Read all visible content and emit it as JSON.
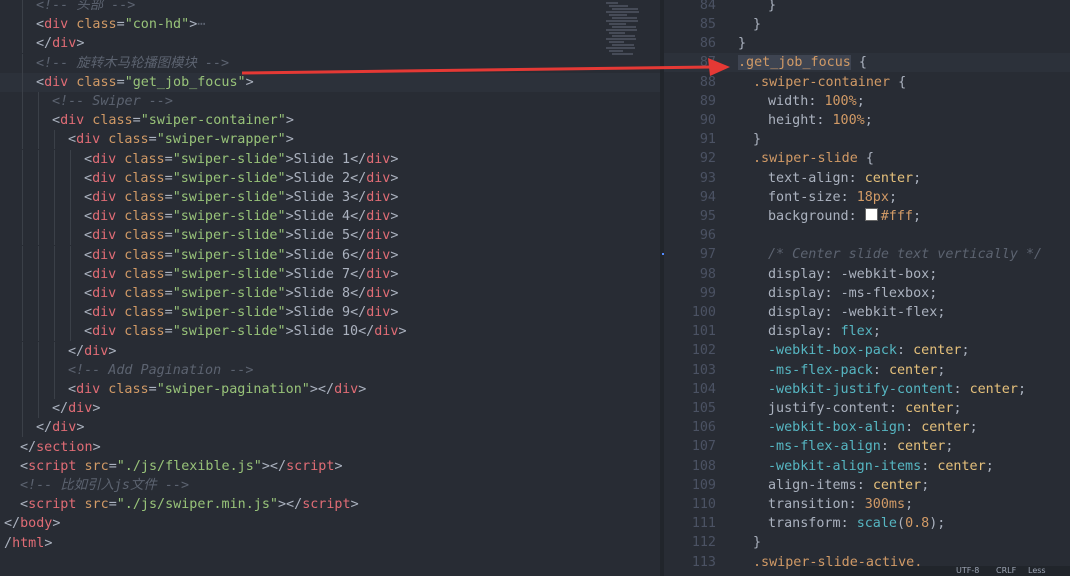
{
  "left_lines": [
    {
      "indent": 2,
      "html": [
        [
          "cm",
          "<!-- 头部 -->"
        ]
      ]
    },
    {
      "indent": 2,
      "html": [
        [
          "pn",
          "<"
        ],
        [
          "tg",
          "div"
        ],
        [
          "at",
          " class"
        ],
        [
          "pn",
          "="
        ],
        [
          "st",
          "\"con-hd\""
        ],
        [
          "pn",
          ">"
        ],
        [
          "cm",
          "⋯"
        ]
      ]
    },
    {
      "indent": 2,
      "html": [
        [
          "pn",
          "</"
        ],
        [
          "tg",
          "div"
        ],
        [
          "pn",
          ">"
        ]
      ]
    },
    {
      "indent": 2,
      "html": [
        [
          "cm",
          "<!-- 旋转木马轮播图模块 -->"
        ]
      ]
    },
    {
      "indent": 2,
      "html": [
        [
          "pn",
          "<"
        ],
        [
          "tg",
          "div"
        ],
        [
          "at",
          " class"
        ],
        [
          "pn",
          "="
        ],
        [
          "st",
          "\"get_job_focus\""
        ],
        [
          "pn",
          ">"
        ]
      ]
    },
    {
      "indent": 3,
      "html": [
        [
          "cm",
          "<!-- Swiper -->"
        ]
      ]
    },
    {
      "indent": 3,
      "html": [
        [
          "pn",
          "<"
        ],
        [
          "tg",
          "div"
        ],
        [
          "at",
          " class"
        ],
        [
          "pn",
          "="
        ],
        [
          "st",
          "\"swiper-container\""
        ],
        [
          "pn",
          ">"
        ]
      ]
    },
    {
      "indent": 4,
      "html": [
        [
          "pn",
          "<"
        ],
        [
          "tg",
          "div"
        ],
        [
          "at",
          " class"
        ],
        [
          "pn",
          "="
        ],
        [
          "st",
          "\"swiper-wrapper\""
        ],
        [
          "pn",
          ">"
        ]
      ]
    },
    {
      "indent": 5,
      "html": [
        [
          "pn",
          "<"
        ],
        [
          "tg",
          "div"
        ],
        [
          "at",
          " class"
        ],
        [
          "pn",
          "="
        ],
        [
          "st",
          "\"swiper-slide\""
        ],
        [
          "pn",
          ">"
        ],
        [
          "tx",
          "Slide 1"
        ],
        [
          "pn",
          "</"
        ],
        [
          "tg",
          "div"
        ],
        [
          "pn",
          ">"
        ]
      ]
    },
    {
      "indent": 5,
      "html": [
        [
          "pn",
          "<"
        ],
        [
          "tg",
          "div"
        ],
        [
          "at",
          " class"
        ],
        [
          "pn",
          "="
        ],
        [
          "st",
          "\"swiper-slide\""
        ],
        [
          "pn",
          ">"
        ],
        [
          "tx",
          "Slide 2"
        ],
        [
          "pn",
          "</"
        ],
        [
          "tg",
          "div"
        ],
        [
          "pn",
          ">"
        ]
      ]
    },
    {
      "indent": 5,
      "html": [
        [
          "pn",
          "<"
        ],
        [
          "tg",
          "div"
        ],
        [
          "at",
          " class"
        ],
        [
          "pn",
          "="
        ],
        [
          "st",
          "\"swiper-slide\""
        ],
        [
          "pn",
          ">"
        ],
        [
          "tx",
          "Slide 3"
        ],
        [
          "pn",
          "</"
        ],
        [
          "tg",
          "div"
        ],
        [
          "pn",
          ">"
        ]
      ]
    },
    {
      "indent": 5,
      "html": [
        [
          "pn",
          "<"
        ],
        [
          "tg",
          "div"
        ],
        [
          "at",
          " class"
        ],
        [
          "pn",
          "="
        ],
        [
          "st",
          "\"swiper-slide\""
        ],
        [
          "pn",
          ">"
        ],
        [
          "tx",
          "Slide 4"
        ],
        [
          "pn",
          "</"
        ],
        [
          "tg",
          "div"
        ],
        [
          "pn",
          ">"
        ]
      ]
    },
    {
      "indent": 5,
      "html": [
        [
          "pn",
          "<"
        ],
        [
          "tg",
          "div"
        ],
        [
          "at",
          " class"
        ],
        [
          "pn",
          "="
        ],
        [
          "st",
          "\"swiper-slide\""
        ],
        [
          "pn",
          ">"
        ],
        [
          "tx",
          "Slide 5"
        ],
        [
          "pn",
          "</"
        ],
        [
          "tg",
          "div"
        ],
        [
          "pn",
          ">"
        ]
      ]
    },
    {
      "indent": 5,
      "html": [
        [
          "pn",
          "<"
        ],
        [
          "tg",
          "div"
        ],
        [
          "at",
          " class"
        ],
        [
          "pn",
          "="
        ],
        [
          "st",
          "\"swiper-slide\""
        ],
        [
          "pn",
          ">"
        ],
        [
          "tx",
          "Slide 6"
        ],
        [
          "pn",
          "</"
        ],
        [
          "tg",
          "div"
        ],
        [
          "pn",
          ">"
        ]
      ]
    },
    {
      "indent": 5,
      "html": [
        [
          "pn",
          "<"
        ],
        [
          "tg",
          "div"
        ],
        [
          "at",
          " class"
        ],
        [
          "pn",
          "="
        ],
        [
          "st",
          "\"swiper-slide\""
        ],
        [
          "pn",
          ">"
        ],
        [
          "tx",
          "Slide 7"
        ],
        [
          "pn",
          "</"
        ],
        [
          "tg",
          "div"
        ],
        [
          "pn",
          ">"
        ]
      ]
    },
    {
      "indent": 5,
      "html": [
        [
          "pn",
          "<"
        ],
        [
          "tg",
          "div"
        ],
        [
          "at",
          " class"
        ],
        [
          "pn",
          "="
        ],
        [
          "st",
          "\"swiper-slide\""
        ],
        [
          "pn",
          ">"
        ],
        [
          "tx",
          "Slide 8"
        ],
        [
          "pn",
          "</"
        ],
        [
          "tg",
          "div"
        ],
        [
          "pn",
          ">"
        ]
      ]
    },
    {
      "indent": 5,
      "html": [
        [
          "pn",
          "<"
        ],
        [
          "tg",
          "div"
        ],
        [
          "at",
          " class"
        ],
        [
          "pn",
          "="
        ],
        [
          "st",
          "\"swiper-slide\""
        ],
        [
          "pn",
          ">"
        ],
        [
          "tx",
          "Slide 9"
        ],
        [
          "pn",
          "</"
        ],
        [
          "tg",
          "div"
        ],
        [
          "pn",
          ">"
        ]
      ]
    },
    {
      "indent": 5,
      "html": [
        [
          "pn",
          "<"
        ],
        [
          "tg",
          "div"
        ],
        [
          "at",
          " class"
        ],
        [
          "pn",
          "="
        ],
        [
          "st",
          "\"swiper-slide\""
        ],
        [
          "pn",
          ">"
        ],
        [
          "tx",
          "Slide 10"
        ],
        [
          "pn",
          "</"
        ],
        [
          "tg",
          "div"
        ],
        [
          "pn",
          ">"
        ]
      ]
    },
    {
      "indent": 4,
      "html": [
        [
          "pn",
          "</"
        ],
        [
          "tg",
          "div"
        ],
        [
          "pn",
          ">"
        ]
      ]
    },
    {
      "indent": 4,
      "html": [
        [
          "cm",
          "<!-- Add Pagination -->"
        ]
      ]
    },
    {
      "indent": 4,
      "html": [
        [
          "pn",
          "<"
        ],
        [
          "tg",
          "div"
        ],
        [
          "at",
          " class"
        ],
        [
          "pn",
          "="
        ],
        [
          "st",
          "\"swiper-pagination\""
        ],
        [
          "pn",
          "></"
        ],
        [
          "tg",
          "div"
        ],
        [
          "pn",
          ">"
        ]
      ]
    },
    {
      "indent": 3,
      "html": [
        [
          "pn",
          "</"
        ],
        [
          "tg",
          "div"
        ],
        [
          "pn",
          ">"
        ]
      ]
    },
    {
      "indent": 2,
      "html": [
        [
          "pn",
          "</"
        ],
        [
          "tg",
          "div"
        ],
        [
          "pn",
          ">"
        ]
      ]
    },
    {
      "indent": 1,
      "html": [
        [
          "pn",
          "</"
        ],
        [
          "tg",
          "section"
        ],
        [
          "pn",
          ">"
        ]
      ]
    },
    {
      "indent": 1,
      "html": [
        [
          "pn",
          "<"
        ],
        [
          "tg",
          "script"
        ],
        [
          "at",
          " src"
        ],
        [
          "pn",
          "="
        ],
        [
          "st",
          "\"./js/flexible.js\""
        ],
        [
          "pn",
          "></"
        ],
        [
          "tg",
          "script"
        ],
        [
          "pn",
          ">"
        ]
      ]
    },
    {
      "indent": 1,
      "html": [
        [
          "cm",
          "<!-- 比如引入js文件 -->"
        ]
      ]
    },
    {
      "indent": 1,
      "html": [
        [
          "pn",
          "<"
        ],
        [
          "tg",
          "script"
        ],
        [
          "at",
          " src"
        ],
        [
          "pn",
          "="
        ],
        [
          "st",
          "\"./js/swiper.min.js\""
        ],
        [
          "pn",
          "></"
        ],
        [
          "tg",
          "script"
        ],
        [
          "pn",
          ">"
        ]
      ]
    },
    {
      "indent": 0,
      "html": [
        [
          "pn",
          "</"
        ],
        [
          "tg",
          "body"
        ],
        [
          "pn",
          ">"
        ]
      ]
    },
    {
      "indent": 0,
      "html": [
        [
          "pn",
          "/"
        ],
        [
          "tg",
          "html"
        ],
        [
          "pn",
          ">"
        ]
      ]
    }
  ],
  "right_lines": [
    {
      "n": "84",
      "indent": 2,
      "html": [
        [
          "pn",
          "}"
        ]
      ]
    },
    {
      "n": "85",
      "indent": 1,
      "html": [
        [
          "pn",
          "}"
        ]
      ]
    },
    {
      "n": "86",
      "indent": 0,
      "html": [
        [
          "pn",
          "}"
        ]
      ]
    },
    {
      "n": "87",
      "indent": 0,
      "html": [
        [
          "sel",
          ".get_job_focus"
        ],
        [
          "pn",
          " {"
        ]
      ]
    },
    {
      "n": "88",
      "indent": 1,
      "html": [
        [
          "sel",
          ".swiper-container"
        ],
        [
          "pn",
          " {"
        ]
      ]
    },
    {
      "n": "89",
      "indent": 2,
      "html": [
        [
          "pr",
          "width"
        ],
        [
          "pn",
          ": "
        ],
        [
          "nu",
          "100%"
        ],
        [
          "pn",
          ";"
        ]
      ]
    },
    {
      "n": "90",
      "indent": 2,
      "html": [
        [
          "pr",
          "height"
        ],
        [
          "pn",
          ": "
        ],
        [
          "nu",
          "100%"
        ],
        [
          "pn",
          ";"
        ]
      ]
    },
    {
      "n": "91",
      "indent": 1,
      "html": [
        [
          "pn",
          "}"
        ]
      ]
    },
    {
      "n": "92",
      "indent": 1,
      "html": [
        [
          "sel",
          ".swiper-slide"
        ],
        [
          "pn",
          " {"
        ]
      ]
    },
    {
      "n": "93",
      "indent": 2,
      "html": [
        [
          "pr",
          "text-align"
        ],
        [
          "pn",
          ": "
        ],
        [
          "vp",
          "center"
        ],
        [
          "pn",
          ";"
        ]
      ]
    },
    {
      "n": "94",
      "indent": 2,
      "html": [
        [
          "pr",
          "font-size"
        ],
        [
          "pn",
          ": "
        ],
        [
          "nu",
          "18px"
        ],
        [
          "pn",
          ";"
        ]
      ]
    },
    {
      "n": "95",
      "indent": 2,
      "html": [
        [
          "pr",
          "background"
        ],
        [
          "pn",
          ": "
        ],
        [
          "swatch",
          "#fff"
        ],
        [
          "nu",
          "#fff"
        ],
        [
          "pn",
          ";"
        ]
      ]
    },
    {
      "n": "96",
      "indent": 0,
      "html": []
    },
    {
      "n": "97",
      "indent": 2,
      "html": [
        [
          "cm",
          "/* Center slide text vertically */"
        ]
      ]
    },
    {
      "n": "98",
      "indent": 2,
      "html": [
        [
          "pr",
          "display"
        ],
        [
          "pn",
          ": "
        ],
        [
          "pr",
          "-webkit-box"
        ],
        [
          "pn",
          ";"
        ]
      ]
    },
    {
      "n": "99",
      "indent": 2,
      "html": [
        [
          "pr",
          "display"
        ],
        [
          "pn",
          ": "
        ],
        [
          "pr",
          "-ms-flexbox"
        ],
        [
          "pn",
          ";"
        ]
      ]
    },
    {
      "n": "100",
      "indent": 2,
      "html": [
        [
          "pr",
          "display"
        ],
        [
          "pn",
          ": "
        ],
        [
          "pr",
          "-webkit-flex"
        ],
        [
          "pn",
          ";"
        ]
      ]
    },
    {
      "n": "101",
      "indent": 2,
      "html": [
        [
          "pr",
          "display"
        ],
        [
          "pn",
          ": "
        ],
        [
          "kw",
          "flex"
        ],
        [
          "pn",
          ";"
        ]
      ]
    },
    {
      "n": "102",
      "indent": 2,
      "html": [
        [
          "kw",
          "-webkit-box-pack"
        ],
        [
          "pn",
          ": "
        ],
        [
          "vp",
          "center"
        ],
        [
          "pn",
          ";"
        ]
      ]
    },
    {
      "n": "103",
      "indent": 2,
      "html": [
        [
          "kw",
          "-ms-flex-pack"
        ],
        [
          "pn",
          ": "
        ],
        [
          "vp",
          "center"
        ],
        [
          "pn",
          ";"
        ]
      ]
    },
    {
      "n": "104",
      "indent": 2,
      "html": [
        [
          "kw",
          "-webkit-justify-content"
        ],
        [
          "pn",
          ": "
        ],
        [
          "vp",
          "center"
        ],
        [
          "pn",
          ";"
        ]
      ]
    },
    {
      "n": "105",
      "indent": 2,
      "html": [
        [
          "pr",
          "justify-content"
        ],
        [
          "pn",
          ": "
        ],
        [
          "vp",
          "center"
        ],
        [
          "pn",
          ";"
        ]
      ]
    },
    {
      "n": "106",
      "indent": 2,
      "html": [
        [
          "kw",
          "-webkit-box-align"
        ],
        [
          "pn",
          ": "
        ],
        [
          "vp",
          "center"
        ],
        [
          "pn",
          ";"
        ]
      ]
    },
    {
      "n": "107",
      "indent": 2,
      "html": [
        [
          "kw",
          "-ms-flex-align"
        ],
        [
          "pn",
          ": "
        ],
        [
          "vp",
          "center"
        ],
        [
          "pn",
          ";"
        ]
      ]
    },
    {
      "n": "108",
      "indent": 2,
      "html": [
        [
          "kw",
          "-webkit-align-items"
        ],
        [
          "pn",
          ": "
        ],
        [
          "vp",
          "center"
        ],
        [
          "pn",
          ";"
        ]
      ]
    },
    {
      "n": "109",
      "indent": 2,
      "html": [
        [
          "pr",
          "align-items"
        ],
        [
          "pn",
          ": "
        ],
        [
          "vp",
          "center"
        ],
        [
          "pn",
          ";"
        ]
      ]
    },
    {
      "n": "110",
      "indent": 2,
      "html": [
        [
          "pr",
          "transition"
        ],
        [
          "pn",
          ": "
        ],
        [
          "nu",
          "300ms"
        ],
        [
          "pn",
          ";"
        ]
      ]
    },
    {
      "n": "111",
      "indent": 2,
      "html": [
        [
          "pr",
          "transform"
        ],
        [
          "pn",
          ": "
        ],
        [
          "fn",
          "scale"
        ],
        [
          "pn",
          "("
        ],
        [
          "nu",
          "0.8"
        ],
        [
          "pn",
          ");"
        ]
      ]
    },
    {
      "n": "112",
      "indent": 1,
      "html": [
        [
          "pn",
          "}"
        ]
      ]
    },
    {
      "n": "113",
      "indent": 1,
      "html": [
        [
          "sel",
          ".swiper-slide-active,"
        ]
      ]
    }
  ],
  "status": {
    "items": [
      "UTF-8",
      "CRLF",
      "Less"
    ]
  },
  "colors": {
    "arrow": "#e53935",
    "bg": "#282c34"
  }
}
